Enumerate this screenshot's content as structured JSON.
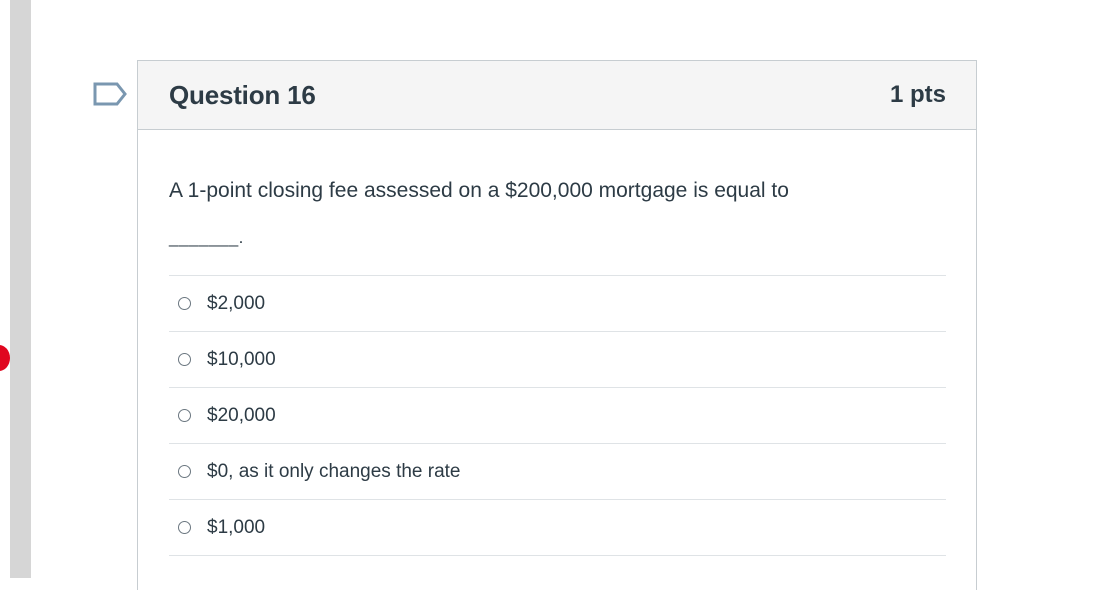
{
  "question": {
    "title": "Question 16",
    "points": "1 pts",
    "text": "A 1-point closing fee assessed on a $200,000 mortgage is equal to",
    "blank": "_______."
  },
  "icons": {
    "flag": "flag-question-icon",
    "radio": "radio-button-icon"
  },
  "answers": [
    {
      "label": "$2,000"
    },
    {
      "label": "$10,000"
    },
    {
      "label": "$20,000"
    },
    {
      "label": "$0, as it only changes the rate"
    },
    {
      "label": "$1,000"
    }
  ],
  "colors": {
    "text": "#2d3b45",
    "header_bg": "#f5f5f5",
    "border": "#c7cdd1",
    "flag_outline": "#7a97b0",
    "notification": "#e0061f"
  }
}
